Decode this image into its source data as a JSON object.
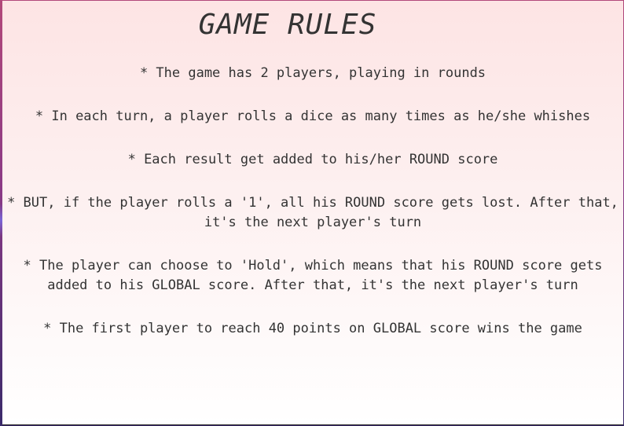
{
  "modal": {
    "title": "GAME RULES",
    "rules": [
      "* The game has 2 players, playing in rounds",
      "* In each turn, a player rolls a dice as many times as he/she whishes",
      "* Each result get added to his/her ROUND score",
      "* BUT, if the player rolls a '1', all his ROUND score gets lost. After that, it's the next player's turn",
      "* The player can choose to 'Hold', which means that his ROUND score gets added to his GLOBAL score. After that, it's the next player's turn",
      "* The first player to reach 40 points on GLOBAL score wins the game"
    ]
  },
  "colors": {
    "modal_top": "#fde4e4",
    "modal_bottom": "#ffffff",
    "text": "#333333",
    "backdrop": "#8a3a86"
  }
}
